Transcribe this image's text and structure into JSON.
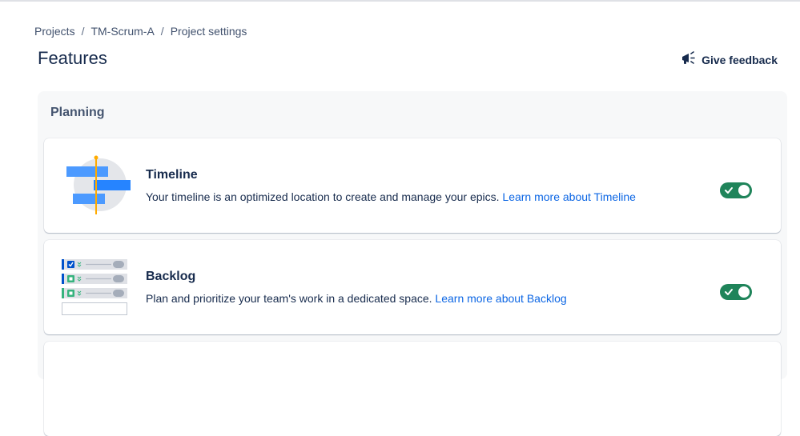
{
  "breadcrumb": {
    "items": [
      "Projects",
      "TM-Scrum-A",
      "Project settings"
    ],
    "separator": "/"
  },
  "page": {
    "title": "Features",
    "feedback_label": "Give feedback",
    "feedback_icon": "megaphone-icon"
  },
  "panel": {
    "title": "Planning"
  },
  "features": [
    {
      "title": "Timeline",
      "description": "Your timeline is an optimized location to create and manage your epics.",
      "link": "Learn more about Timeline",
      "enabled": true,
      "illustration": "timeline-illustration"
    },
    {
      "title": "Backlog",
      "description": "Plan and prioritize your team's work in a dedicated space.",
      "link": "Learn more about Backlog",
      "enabled": true,
      "illustration": "backlog-illustration"
    }
  ],
  "colors": {
    "toggle_on": "#1f845a",
    "link": "#0c66e4",
    "text": "#172b4d",
    "panel_bg": "#f7f8f9"
  }
}
